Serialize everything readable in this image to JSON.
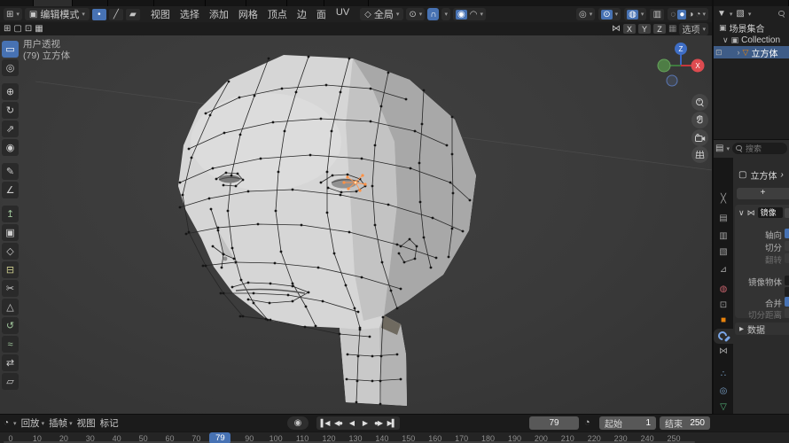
{
  "header": {
    "mode": "编辑模式",
    "menus": [
      "视图",
      "选择",
      "添加",
      "网格",
      "顶点",
      "边",
      "面",
      "UV"
    ],
    "orientation": "全局",
    "axis_toggles": [
      "X",
      "Y",
      "Z"
    ],
    "options": "选项"
  },
  "viewport": {
    "info_line1": "用户透视",
    "info_line2": "(79) 立方体",
    "axis_z": "Z",
    "axis_x": "X",
    "tools": [
      {
        "name": "tool-tweak-select",
        "glyph": "▭"
      },
      {
        "name": "tool-cursor",
        "glyph": "◎"
      },
      {
        "name": "tool-move",
        "glyph": "⊕"
      },
      {
        "name": "tool-rotate",
        "glyph": "↻"
      },
      {
        "name": "tool-scale",
        "glyph": "⇗"
      },
      {
        "name": "tool-transform",
        "glyph": "◉"
      },
      {
        "name": "tool-annotate",
        "glyph": "✎"
      },
      {
        "name": "tool-measure",
        "glyph": "∠"
      },
      {
        "name": "tool-extrude",
        "glyph": "↥",
        "color": "#9ec49a"
      },
      {
        "name": "tool-inset-faces",
        "glyph": "▣"
      },
      {
        "name": "tool-bevel",
        "glyph": "◇"
      },
      {
        "name": "tool-loop-cut",
        "glyph": "⊟",
        "color": "#cfcf8f"
      },
      {
        "name": "tool-knife",
        "glyph": "✂"
      },
      {
        "name": "tool-poly-build",
        "glyph": "△"
      },
      {
        "name": "tool-spin",
        "glyph": "↺",
        "color": "#9ec49a"
      },
      {
        "name": "tool-smooth",
        "glyph": "≈",
        "color": "#9ec49a"
      },
      {
        "name": "tool-edge-slide",
        "glyph": "⇄"
      },
      {
        "name": "tool-rip-region",
        "glyph": "▱"
      }
    ]
  },
  "outliner": {
    "scene_collection": "场景集合",
    "collection": "Collection",
    "object": "立方体"
  },
  "properties": {
    "search_placeholder": "搜索",
    "breadcrumb_object": "立方体",
    "modifier_name": "镜像",
    "labels": {
      "axis": "轴向",
      "bisect": "切分",
      "flip": "翻转",
      "mirror_object": "镜像物体",
      "merge": "合并",
      "bisect_distance": "切分距离",
      "data_section": "数据"
    },
    "tabs": [
      {
        "name": "tab-tool",
        "glyph": "╳",
        "color": "#9f9f9f"
      },
      {
        "name": "tab-render",
        "glyph": "▤",
        "color": "#9f9f9f"
      },
      {
        "name": "tab-output",
        "glyph": "▥",
        "color": "#9f9f9f"
      },
      {
        "name": "tab-view-layer",
        "glyph": "▧",
        "color": "#9f9f9f"
      },
      {
        "name": "tab-scene",
        "glyph": "⊿",
        "color": "#9f9f9f"
      },
      {
        "name": "tab-world",
        "glyph": "◍",
        "color": "#c2606a"
      },
      {
        "name": "tab-collection",
        "glyph": "⊡",
        "color": "#9f9f9f"
      },
      {
        "name": "tab-object",
        "glyph": "■",
        "color": "#e8830c"
      },
      {
        "name": "tab-modifiers",
        "glyph": "",
        "color": "#7aa6e8",
        "active": true
      },
      {
        "name": "tab-constraints",
        "glyph": "⋈",
        "color": "#9f9f9f"
      },
      {
        "name": "tab-particles",
        "glyph": "∴",
        "color": "#7ba2c9"
      },
      {
        "name": "tab-physics",
        "glyph": "◎",
        "color": "#7ba2c9"
      },
      {
        "name": "tab-object-data",
        "glyph": "▽",
        "color": "#53b077"
      },
      {
        "name": "tab-material",
        "glyph": "◑",
        "color": "#c2606a"
      }
    ]
  },
  "timeline": {
    "menus": [
      "回放",
      "插帧",
      "视图",
      "标记"
    ],
    "current_frame": "79",
    "start_label": "起始",
    "start_value": "1",
    "end_label": "结束",
    "end_value": "250",
    "playhead_frame": 79,
    "ruler_ticks": [
      0,
      10,
      20,
      30,
      40,
      50,
      60,
      70,
      90,
      100,
      110,
      120,
      130,
      140,
      150,
      160,
      170,
      180,
      190,
      200,
      210,
      220,
      230,
      240,
      250
    ]
  },
  "icons": {
    "dropdown": "▾",
    "expand_down": "∨",
    "collapsed": "▸",
    "chevron_right": "›",
    "plus": "+",
    "record": "◉",
    "clock": "◔",
    "magnet": "∩",
    "butterfly": "⋈",
    "orientation": "◇",
    "pivot": "⊙",
    "falloff": "◠",
    "proportional": "◉",
    "editor_grid": "⊞",
    "editmode_cube": "▣",
    "vertex_mode": "•",
    "edge_mode": "╱",
    "face_mode": "▰",
    "visibility": "◎",
    "gizmo": "⊙",
    "overlay": "◍",
    "xray": "▥",
    "wireframe_sphere": "◌",
    "solid_sphere": "●",
    "material_sphere": "◑",
    "rendered_sphere": "◔",
    "overlap": "⊞",
    "box2": "▢",
    "plusbox": "⊡",
    "gridbox": "▦",
    "filter": "▼",
    "image": "▧",
    "box": "▣",
    "screen": "⊡",
    "mesh_tri": "▽",
    "properties_editor": "▤",
    "playback": [
      "▌◀",
      "◀●",
      "◀",
      "▶",
      "●▶",
      "▶▌"
    ]
  }
}
